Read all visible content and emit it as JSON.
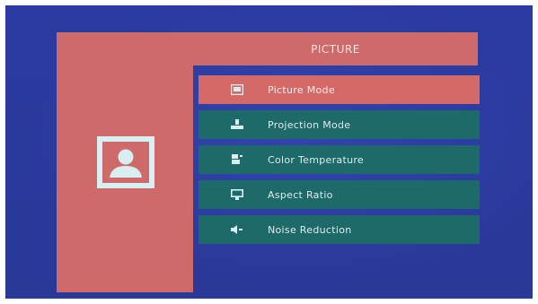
{
  "header": {
    "title": "PICTURE"
  },
  "menu": {
    "items": [
      {
        "label": "Picture Mode",
        "icon": "picture-mode-icon",
        "selected": true
      },
      {
        "label": "Projection Mode",
        "icon": "projection-mode-icon",
        "selected": false
      },
      {
        "label": "Color Temperature",
        "icon": "color-temperature-icon",
        "selected": false
      },
      {
        "label": "Aspect Ratio",
        "icon": "aspect-ratio-icon",
        "selected": false
      },
      {
        "label": "Noise Reduction",
        "icon": "noise-reduction-icon",
        "selected": false
      }
    ]
  },
  "colors": {
    "background": "#2c3a9c",
    "accent": "#cf6a6a",
    "item": "#1e6a6a",
    "icon": "#cfe8ea"
  },
  "category_icon": "picture-category-icon"
}
